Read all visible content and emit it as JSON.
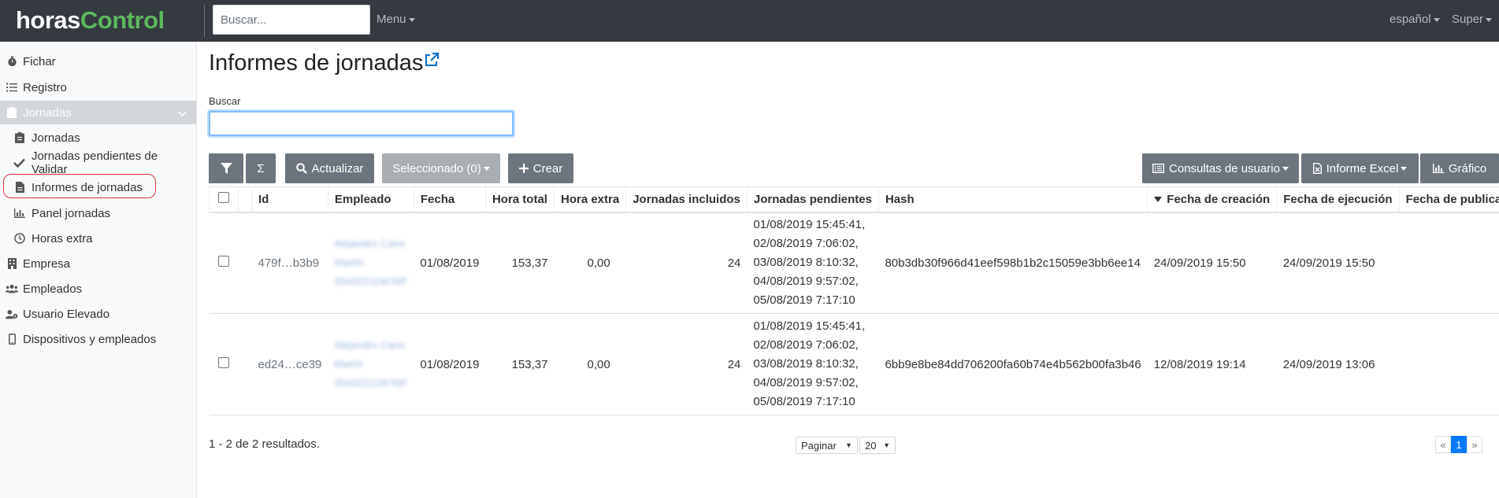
{
  "header": {
    "logo_part1": "horas",
    "logo_part2": "Control",
    "search_placeholder": "Buscar...",
    "menu_label": "Menu",
    "language_label": "español",
    "user_label": "Super"
  },
  "sidebar": {
    "items": [
      {
        "label": "Fichar",
        "icon": "stopwatch-icon"
      },
      {
        "label": "Registro",
        "icon": "list-icon"
      },
      {
        "label": "Jornadas",
        "icon": "clipboard-icon",
        "active": true
      },
      {
        "label": "Jornadas",
        "icon": "clipboard-icon"
      },
      {
        "label": "Jornadas pendientes de Validar",
        "icon": "check-icon"
      },
      {
        "label": "Informes de jornadas",
        "icon": "file-icon"
      },
      {
        "label": "Panel jornadas",
        "icon": "bar-chart-icon"
      },
      {
        "label": "Horas extra",
        "icon": "clock-icon"
      },
      {
        "label": "Empresa",
        "icon": "building-icon"
      },
      {
        "label": "Empleados",
        "icon": "users-icon"
      },
      {
        "label": "Usuario Elevado",
        "icon": "user-cog-icon"
      },
      {
        "label": "Dispositivos y empleados",
        "icon": "mobile-icon"
      }
    ]
  },
  "main": {
    "title": "Informes de jornadas",
    "search_label": "Buscar",
    "search_value": ""
  },
  "toolbar": {
    "sum_label": "Σ",
    "refresh_label": "Actualizar",
    "selected_label": "Seleccionado (0)",
    "create_label": "Crear",
    "queries_label": "Consultas de usuario",
    "excel_label": "Informe Excel",
    "chart_label": "Gráfico"
  },
  "table": {
    "headers": {
      "id": "Id",
      "empleado": "Empleado",
      "fecha": "Fecha",
      "hora_total": "Hora total",
      "hora_extra": "Hora extra",
      "jornadas_incluidos": "Jornadas incluidos",
      "jornadas_pendientes": "Jornadas pendientes",
      "hash": "Hash",
      "fecha_creacion": "Fecha de creación",
      "fecha_ejecucion": "Fecha de ejecución",
      "fecha_publicacion": "Fecha de publicación"
    },
    "rows": [
      {
        "id": "479f…b3b9",
        "empleado": [
          "Alejandro Cano",
          "Martín",
          "05432211W.NIF"
        ],
        "fecha": "01/08/2019",
        "hora_total": "153,37",
        "hora_extra": "0,00",
        "jornadas_incluidos": "24",
        "pendientes": [
          "01/08/2019 15:45:41,",
          "02/08/2019 7:06:02,",
          "03/08/2019 8:10:32,",
          "04/08/2019 9:57:02,",
          "05/08/2019 7:17:10"
        ],
        "hash": "80b3db30f966d41eef598b1b2c15059e3bb6ee14",
        "fecha_creacion": "24/09/2019 15:50",
        "fecha_ejecucion": "24/09/2019 15:50",
        "fecha_publicacion": ""
      },
      {
        "id": "ed24…ce39",
        "empleado": [
          "Alejandro Cano",
          "Martín",
          "05432211W.NIF"
        ],
        "fecha": "01/08/2019",
        "hora_total": "153,37",
        "hora_extra": "0,00",
        "jornadas_incluidos": "24",
        "pendientes": [
          "01/08/2019 15:45:41,",
          "02/08/2019 7:06:02,",
          "03/08/2019 8:10:32,",
          "04/08/2019 9:57:02,",
          "05/08/2019 7:17:10"
        ],
        "hash": "6bb9e8be84dd706200fa60b74e4b562b00fa3b46",
        "fecha_creacion": "12/08/2019 19:14",
        "fecha_ejecucion": "24/09/2019 13:06",
        "fecha_publicacion": ""
      }
    ]
  },
  "footer": {
    "results_text": "1 - 2 de 2 resultados.",
    "paginate_label": "Paginar",
    "page_size": "20",
    "prev": "«",
    "current_page": "1",
    "next": "»"
  },
  "colors": {
    "topbar": "#343a40",
    "logo_green": "#5cb85c",
    "button_gray": "#6c757d",
    "highlight_ring": "#dc3545",
    "active_page": "#007bff"
  }
}
